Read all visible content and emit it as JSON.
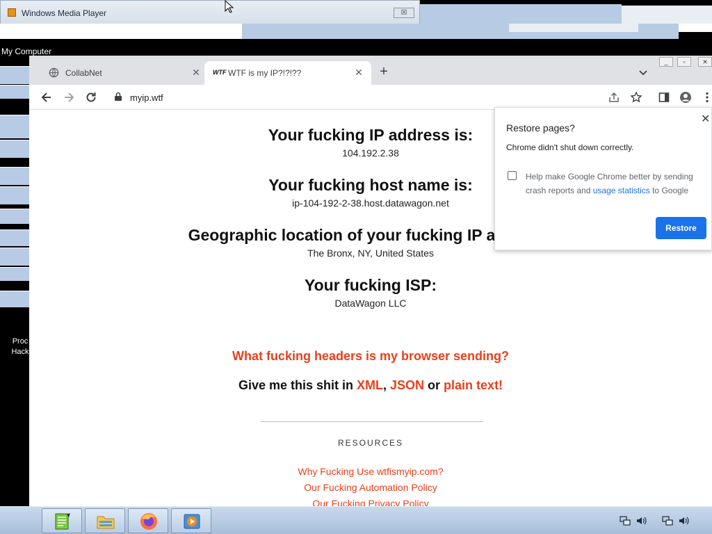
{
  "desktop": {
    "wmp_title": "Windows Media Player",
    "wmp_close": "☒",
    "my_computer": "My Computer",
    "prod_label_1": "Proc",
    "prod_label_2": "Hack"
  },
  "chrome": {
    "tabs": [
      {
        "title": "CollabNet",
        "icon": "globe-icon",
        "active": false
      },
      {
        "title": "WTF is my IP?!?!??",
        "icon": "wtf-logo",
        "active": true,
        "logo_text": "WTF"
      }
    ],
    "tab_close": "✕",
    "new_tab": "+",
    "url": "myip.wtf"
  },
  "page": {
    "ip_heading": "Your fucking IP address is:",
    "ip_value": "104.192.2.38",
    "host_heading": "Your fucking host name is:",
    "host_value": "ip-104-192-2-38.host.datawagon.net",
    "geo_heading": "Geographic location of your fucking IP address:",
    "geo_value": "The Bronx, NY, United States",
    "isp_heading": "Your fucking ISP:",
    "isp_value": "DataWagon LLC",
    "headers_link": "What fucking headers is my browser sending?",
    "formats_prefix": "Give me this shit in ",
    "format_xml": "XML",
    "formats_comma": ", ",
    "format_json": "JSON",
    "formats_or": " or ",
    "format_text": "plain text!",
    "resources_title": "RESOURCES",
    "resource_links": [
      "Why Fucking Use wtfismyip.com?",
      "Our Fucking Automation Policy",
      "Our Fucking Privacy Policy"
    ]
  },
  "restore_popup": {
    "title": "Restore pages?",
    "message": "Chrome didn't shut down correctly.",
    "help_text_1": "Help make Google Chrome better by sending crash reports and ",
    "help_link": "usage statistics",
    "help_text_2": " to Google",
    "checkbox_checked": false,
    "button": "Restore",
    "close": "✕"
  },
  "colors": {
    "accent_red": "#e8401c",
    "chrome_blue": "#1a73e8",
    "taskbar": "#b8cde5"
  }
}
